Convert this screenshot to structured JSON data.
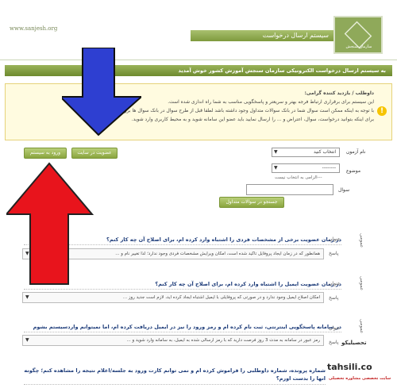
{
  "header": {
    "site_url": "www.sanjesh.org",
    "title": "سیستم ارسال درخواست",
    "logo_text": "سازمان سنجش"
  },
  "strip": {
    "text": "به سیستم ارسال درخواست الکترونیکی سازمان سنجش آموزش کشور خوش آمدید"
  },
  "notice": {
    "lines": [
      "داوطلب / بازدید کننده گرامی:",
      "این سیستم برای برقراری ارتباط فرجه بهتر و سریعتر و پاسخگویی مناسب به شما راه اندازی شده است.",
      "با توجه به اینکه ممکن است سوال شما در بانک سوالات متداول وجود داشته باشد لطفا قبل از طرح سوال در بانک سوال ها بررسی کنید.",
      "برای اینکه بتوانید درخواست، سوال، اعتراض و ... را ارسال نمایید باید عضو این سامانه شوید و به محیط کاربری وارد شوید."
    ]
  },
  "buttons": {
    "register": "عضویت در سایت",
    "login": "ورود به سیستم",
    "search": "جستجو در سوالات متداول"
  },
  "form": {
    "exam_label": "نام آزمون",
    "exam_value": "انتخاب کنید",
    "subject_label": "موضوع",
    "subject_value": "--------",
    "subject_hint": "---الزامی به انتخاب نیست",
    "question_label": "سوال"
  },
  "faq": [
    {
      "question": "در زمان عضویت برخی از مشخصات فردی را اشتباه وارد کرده ام، برای اصلاح آن چه کار کنم؟",
      "title_label": "عنوان",
      "answer_label": "پاسخ",
      "answer": "همانطور که در زمان ایجاد پروفایل تاکید شده است، امکان ویرایش مشخصات فردی وجود ندارد؛ لذا تغییر نام و ...",
      "side": "عمومی"
    },
    {
      "question": "در زمان عضویت ایمیل را اشتباه وارد کرده ام، برای اصلاح آن چه کار کنم؟",
      "title_label": "عنوان",
      "answer_label": "پاسخ",
      "answer": "امکان اصلاح ایمیل وجود ندارد و در صورتی که پروفایلی با ایمیل اشتباه ایجاد کرده اید، لازم است جدید روز ...",
      "side": "عمومی"
    },
    {
      "question": "در سامانه پاسخگویی اینترنتی، ثبت نام کرده ام و رمز ورود را نیز در ایمیل دریافت کرده ام، اما نمیتوانم واردسیستم بشوم",
      "title_label": "عنوان",
      "answer_label": "پاسخ",
      "answer": "رمز عبور در سامانه به مدت 3 روز فرصت دارید که با رمز ارسالی شده به ایمیل، به سامانه وارد شوید و ...",
      "side": "عمومی"
    },
    {
      "question": "شماره پرونده، شماره داوطلبی را فراموش کرده ام و نمی توانم کارت ورود به جلسه/اعلام نتیجه را مشاهده کنم؛ چگونه انها را بدست اورم؟",
      "title_label": "",
      "answer_label": "",
      "answer": "",
      "side": ""
    }
  ],
  "watermark": {
    "brand": "tahsili.co",
    "sub": "سایت تخصصی مشاوره تحصیلی",
    "logo_text": "تحصیلیکو"
  },
  "colors": {
    "green": "#8aa53f",
    "blue_arrow": "#2e3fd1",
    "red_arrow": "#e8141c",
    "notice_bg": "#fffbe0"
  }
}
